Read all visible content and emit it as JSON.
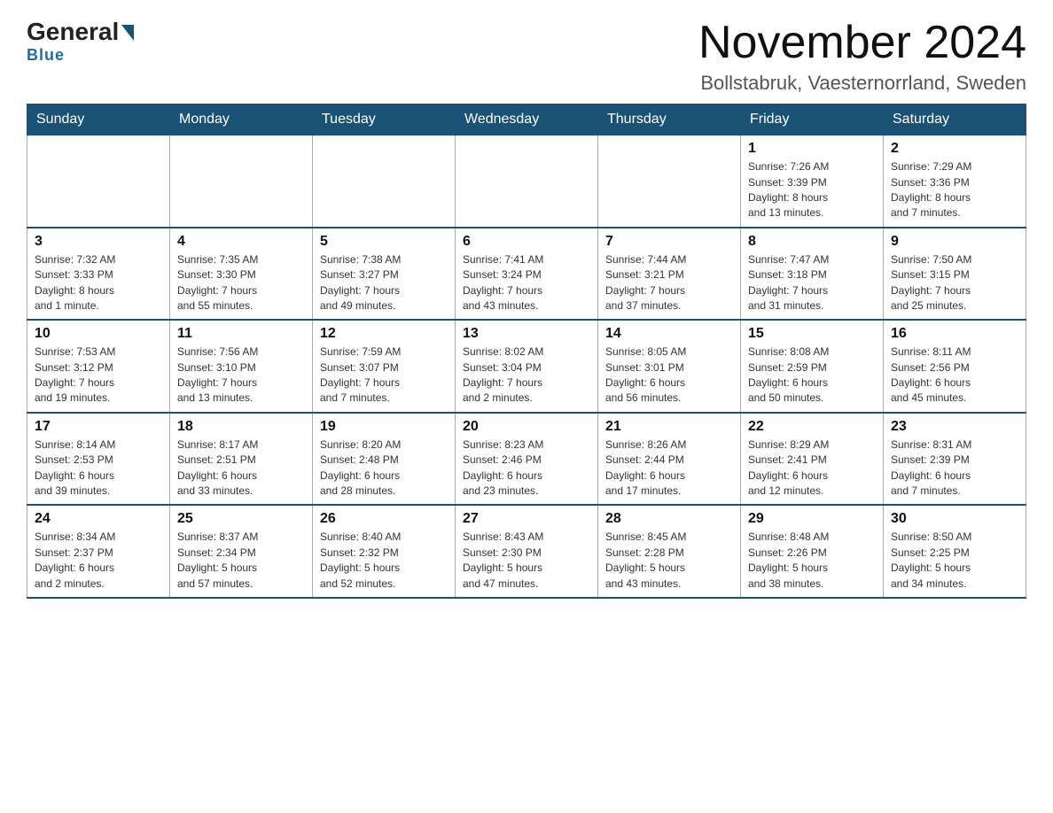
{
  "header": {
    "logo_general": "General",
    "logo_blue": "Blue",
    "main_title": "November 2024",
    "subtitle": "Bollstabruk, Vaesternorrland, Sweden"
  },
  "days_of_week": [
    "Sunday",
    "Monday",
    "Tuesday",
    "Wednesday",
    "Thursday",
    "Friday",
    "Saturday"
  ],
  "weeks": [
    {
      "days": [
        {
          "num": "",
          "info": "",
          "empty": true
        },
        {
          "num": "",
          "info": "",
          "empty": true
        },
        {
          "num": "",
          "info": "",
          "empty": true
        },
        {
          "num": "",
          "info": "",
          "empty": true
        },
        {
          "num": "",
          "info": "",
          "empty": true
        },
        {
          "num": "1",
          "info": "Sunrise: 7:26 AM\nSunset: 3:39 PM\nDaylight: 8 hours\nand 13 minutes.",
          "empty": false
        },
        {
          "num": "2",
          "info": "Sunrise: 7:29 AM\nSunset: 3:36 PM\nDaylight: 8 hours\nand 7 minutes.",
          "empty": false
        }
      ]
    },
    {
      "days": [
        {
          "num": "3",
          "info": "Sunrise: 7:32 AM\nSunset: 3:33 PM\nDaylight: 8 hours\nand 1 minute.",
          "empty": false
        },
        {
          "num": "4",
          "info": "Sunrise: 7:35 AM\nSunset: 3:30 PM\nDaylight: 7 hours\nand 55 minutes.",
          "empty": false
        },
        {
          "num": "5",
          "info": "Sunrise: 7:38 AM\nSunset: 3:27 PM\nDaylight: 7 hours\nand 49 minutes.",
          "empty": false
        },
        {
          "num": "6",
          "info": "Sunrise: 7:41 AM\nSunset: 3:24 PM\nDaylight: 7 hours\nand 43 minutes.",
          "empty": false
        },
        {
          "num": "7",
          "info": "Sunrise: 7:44 AM\nSunset: 3:21 PM\nDaylight: 7 hours\nand 37 minutes.",
          "empty": false
        },
        {
          "num": "8",
          "info": "Sunrise: 7:47 AM\nSunset: 3:18 PM\nDaylight: 7 hours\nand 31 minutes.",
          "empty": false
        },
        {
          "num": "9",
          "info": "Sunrise: 7:50 AM\nSunset: 3:15 PM\nDaylight: 7 hours\nand 25 minutes.",
          "empty": false
        }
      ]
    },
    {
      "days": [
        {
          "num": "10",
          "info": "Sunrise: 7:53 AM\nSunset: 3:12 PM\nDaylight: 7 hours\nand 19 minutes.",
          "empty": false
        },
        {
          "num": "11",
          "info": "Sunrise: 7:56 AM\nSunset: 3:10 PM\nDaylight: 7 hours\nand 13 minutes.",
          "empty": false
        },
        {
          "num": "12",
          "info": "Sunrise: 7:59 AM\nSunset: 3:07 PM\nDaylight: 7 hours\nand 7 minutes.",
          "empty": false
        },
        {
          "num": "13",
          "info": "Sunrise: 8:02 AM\nSunset: 3:04 PM\nDaylight: 7 hours\nand 2 minutes.",
          "empty": false
        },
        {
          "num": "14",
          "info": "Sunrise: 8:05 AM\nSunset: 3:01 PM\nDaylight: 6 hours\nand 56 minutes.",
          "empty": false
        },
        {
          "num": "15",
          "info": "Sunrise: 8:08 AM\nSunset: 2:59 PM\nDaylight: 6 hours\nand 50 minutes.",
          "empty": false
        },
        {
          "num": "16",
          "info": "Sunrise: 8:11 AM\nSunset: 2:56 PM\nDaylight: 6 hours\nand 45 minutes.",
          "empty": false
        }
      ]
    },
    {
      "days": [
        {
          "num": "17",
          "info": "Sunrise: 8:14 AM\nSunset: 2:53 PM\nDaylight: 6 hours\nand 39 minutes.",
          "empty": false
        },
        {
          "num": "18",
          "info": "Sunrise: 8:17 AM\nSunset: 2:51 PM\nDaylight: 6 hours\nand 33 minutes.",
          "empty": false
        },
        {
          "num": "19",
          "info": "Sunrise: 8:20 AM\nSunset: 2:48 PM\nDaylight: 6 hours\nand 28 minutes.",
          "empty": false
        },
        {
          "num": "20",
          "info": "Sunrise: 8:23 AM\nSunset: 2:46 PM\nDaylight: 6 hours\nand 23 minutes.",
          "empty": false
        },
        {
          "num": "21",
          "info": "Sunrise: 8:26 AM\nSunset: 2:44 PM\nDaylight: 6 hours\nand 17 minutes.",
          "empty": false
        },
        {
          "num": "22",
          "info": "Sunrise: 8:29 AM\nSunset: 2:41 PM\nDaylight: 6 hours\nand 12 minutes.",
          "empty": false
        },
        {
          "num": "23",
          "info": "Sunrise: 8:31 AM\nSunset: 2:39 PM\nDaylight: 6 hours\nand 7 minutes.",
          "empty": false
        }
      ]
    },
    {
      "days": [
        {
          "num": "24",
          "info": "Sunrise: 8:34 AM\nSunset: 2:37 PM\nDaylight: 6 hours\nand 2 minutes.",
          "empty": false
        },
        {
          "num": "25",
          "info": "Sunrise: 8:37 AM\nSunset: 2:34 PM\nDaylight: 5 hours\nand 57 minutes.",
          "empty": false
        },
        {
          "num": "26",
          "info": "Sunrise: 8:40 AM\nSunset: 2:32 PM\nDaylight: 5 hours\nand 52 minutes.",
          "empty": false
        },
        {
          "num": "27",
          "info": "Sunrise: 8:43 AM\nSunset: 2:30 PM\nDaylight: 5 hours\nand 47 minutes.",
          "empty": false
        },
        {
          "num": "28",
          "info": "Sunrise: 8:45 AM\nSunset: 2:28 PM\nDaylight: 5 hours\nand 43 minutes.",
          "empty": false
        },
        {
          "num": "29",
          "info": "Sunrise: 8:48 AM\nSunset: 2:26 PM\nDaylight: 5 hours\nand 38 minutes.",
          "empty": false
        },
        {
          "num": "30",
          "info": "Sunrise: 8:50 AM\nSunset: 2:25 PM\nDaylight: 5 hours\nand 34 minutes.",
          "empty": false
        }
      ]
    }
  ]
}
